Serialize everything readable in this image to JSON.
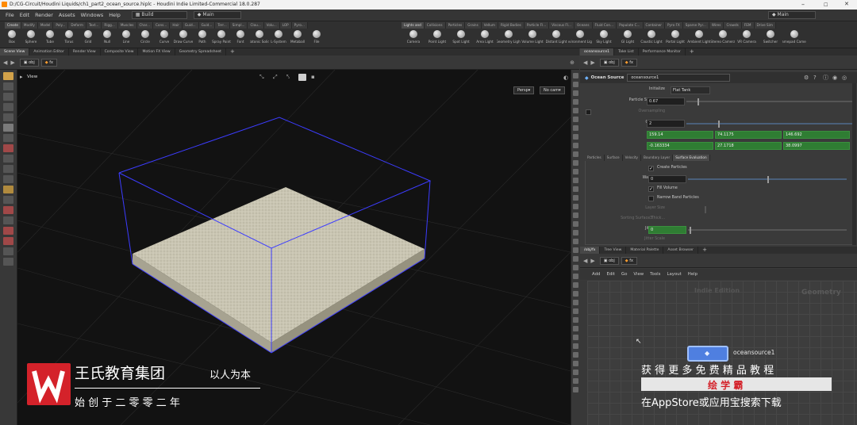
{
  "window": {
    "title": "D:/CG-Circuit/Houdini Liquids/ch1_part2_ocean_source.hiplc - Houdini Indie Limited-Commercial 18.0.287",
    "controls": [
      "–",
      "☐",
      "✕"
    ]
  },
  "menubar": {
    "items": [
      "File",
      "Edit",
      "Render",
      "Assets",
      "Windows",
      "Help"
    ],
    "desktop": "Build",
    "context": "Main",
    "right_context": "Main"
  },
  "shelf": {
    "tabs_left": [
      "Create",
      "Modify",
      "Model",
      "Poly...",
      "Deform",
      "Text...",
      "Rigg...",
      "Muscles",
      "Char...",
      "Cons...",
      "Hair",
      "Guid...",
      "Guid...",
      "Terr...",
      "Simpl...",
      "Clou...",
      "Volu...",
      "LOP",
      "Pyro..."
    ],
    "tabs_right": [
      "Lights and",
      "Collisions",
      "Particles",
      "Grains",
      "Vellum",
      "Rigid Bodies",
      "Particle Fl...",
      "Viscous Fl...",
      "Oceans",
      "Fluid Con...",
      "Populate C...",
      "Container",
      "Pyro FX",
      "Sparse Pyr...",
      "Wires",
      "Crowds",
      "FEM",
      "Drive Sim"
    ],
    "tools_left": [
      "Box",
      "Sphere",
      "Tube",
      "Torus",
      "Grid",
      "Null",
      "Line",
      "Circle",
      "Curve",
      "Draw Curve",
      "Path",
      "Spray Paint",
      "Font",
      "Platonic Solids",
      "L-System",
      "Metaball",
      "File"
    ],
    "tools_right": [
      "Camera",
      "Point Light",
      "Spot Light",
      "Area Light",
      "Geometry Light",
      "Volume Light",
      "Distant Light",
      "Environment Light",
      "Sky Light",
      "GI Light",
      "Caustic Light",
      "Portal Light",
      "Ambient Light",
      "Stereo Camera",
      "VR Camera",
      "Switcher",
      "Gamepad Camera"
    ]
  },
  "pane_tabs_left": [
    "Scene View",
    "Animation Editor",
    "Render View",
    "Composite View",
    "Motion FX View",
    "Geometry Spreadsheet"
  ],
  "pane_tabs_right": [
    "oceansource1",
    "Take List",
    "Performance Monitor"
  ],
  "path": {
    "obj": "obj",
    "node": "fx"
  },
  "viewport": {
    "label": "View",
    "persp": "Persp▾",
    "cam": "No cam▾"
  },
  "params": {
    "node_type": "Ocean Source",
    "node_name": "oceansource1",
    "initialize_label": "Initialize",
    "initialize_value": "Flat Tank",
    "particle_sep_label": "Particle Separation",
    "particle_sep_value": "0.67",
    "oversampling_label": "Oversampling",
    "grid_scale_label": "Grid Scale",
    "grid_scale_value": "2",
    "size_label": "Size",
    "size_values": [
      "159.14",
      "74.1175",
      "146.692"
    ],
    "center_label": "Center",
    "center_values": [
      "-0.163334",
      "27.1718",
      "38.0997"
    ],
    "sub_tabs": [
      "Particles",
      "Surface",
      "Velocity",
      "Boundary Layer",
      "Surface Evaluation"
    ],
    "create_particles": "Create Particles",
    "water_level_label": "Water Level",
    "water_level_value": "0",
    "fill_volume": "Fill Volume",
    "narrow_band": "Narrow Band Particles",
    "layer_size_label": "Layer Size",
    "sorting_label": "Sorting Surface Thick...",
    "sorting_value": "3",
    "jitter_label": "Jitter Seed",
    "jitter_value": "0",
    "jitter_scale_label": "Jitter Scale"
  },
  "network": {
    "tabs": [
      "/obj/fx",
      "Tree View",
      "Material Palette",
      "Asset Browser"
    ],
    "menu": [
      "Add",
      "Edit",
      "Go",
      "View",
      "Tools",
      "Layout",
      "Help"
    ],
    "edition": "Indie Edition",
    "context_label": "Geometry",
    "node_label": "oceansource1"
  },
  "watermark": {
    "brand": "王氏教育集团",
    "slogan": "以人为本",
    "founded": "始 创 于 二 零 零 二 年",
    "promo": "获 得 更 多 免 费 精 品 教 程",
    "app_name": "绘 学 霸",
    "store_line": "在AppStore或应用宝搜索下载"
  },
  "colors": {
    "field_green": "#2f7d33",
    "bbox_line": "#3c3cff",
    "brand_red": "#d4222a",
    "node_blue": "#4f7fe0"
  }
}
